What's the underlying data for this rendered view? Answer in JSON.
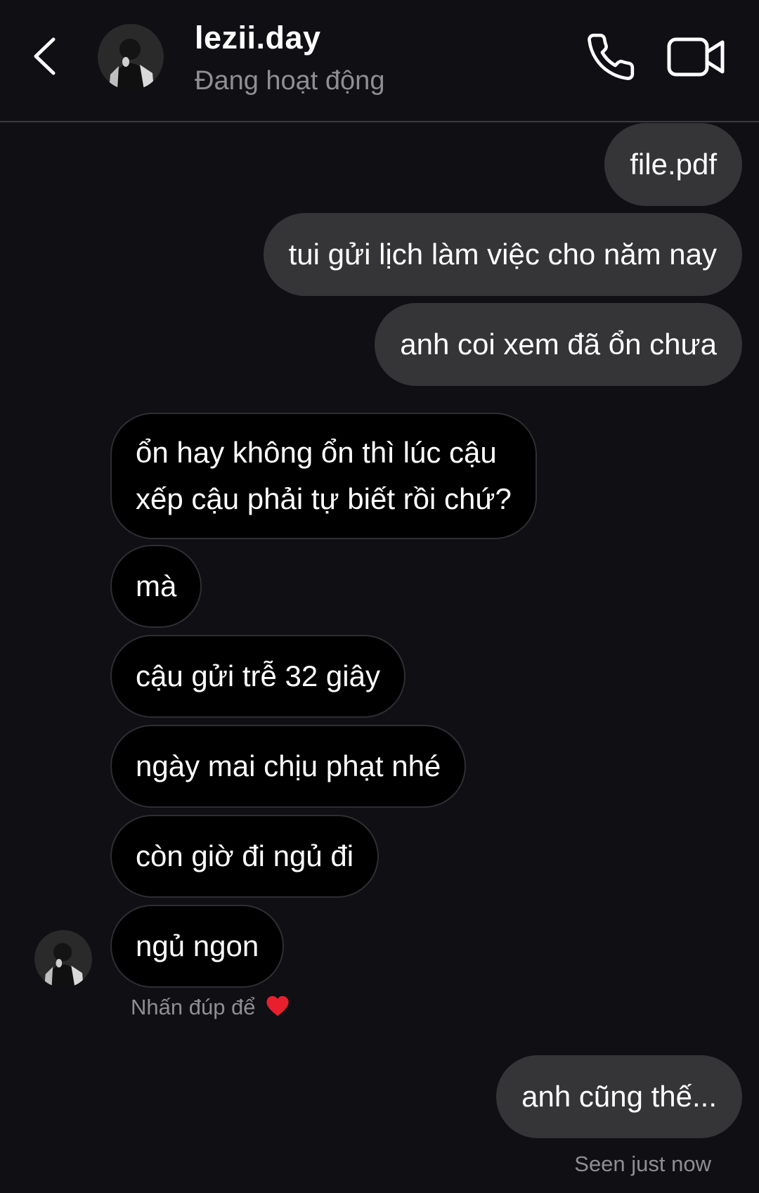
{
  "header": {
    "username": "lezii.day",
    "status": "Đang hoạt động"
  },
  "messages": {
    "m1": "file.pdf",
    "m2": "tui gửi lịch làm việc cho năm nay",
    "m3": "anh coi xem đã ổn chưa",
    "m4_line1": "ổn hay không ổn thì lúc cậu",
    "m4_line2": "xếp cậu phải tự biết rồi chứ?",
    "m5": "mà",
    "m6": "cậu gửi trễ 32 giây",
    "m7": "ngày mai chịu phạt nhé",
    "m8": "còn giờ đi ngủ đi",
    "m9": "ngủ ngon",
    "m10": "anh cũng thế..."
  },
  "hint": "Nhấn đúp để",
  "seen": "Seen just now",
  "icons": {
    "back": "chevron-left-icon",
    "call": "phone-icon",
    "video": "video-camera-icon",
    "heart": "heart-icon"
  },
  "colors": {
    "background": "#0f0f14",
    "sent_bubble": "#353538",
    "received_bubble": "#000000",
    "heart": "#e8202d",
    "muted_text": "#8e8e93"
  }
}
